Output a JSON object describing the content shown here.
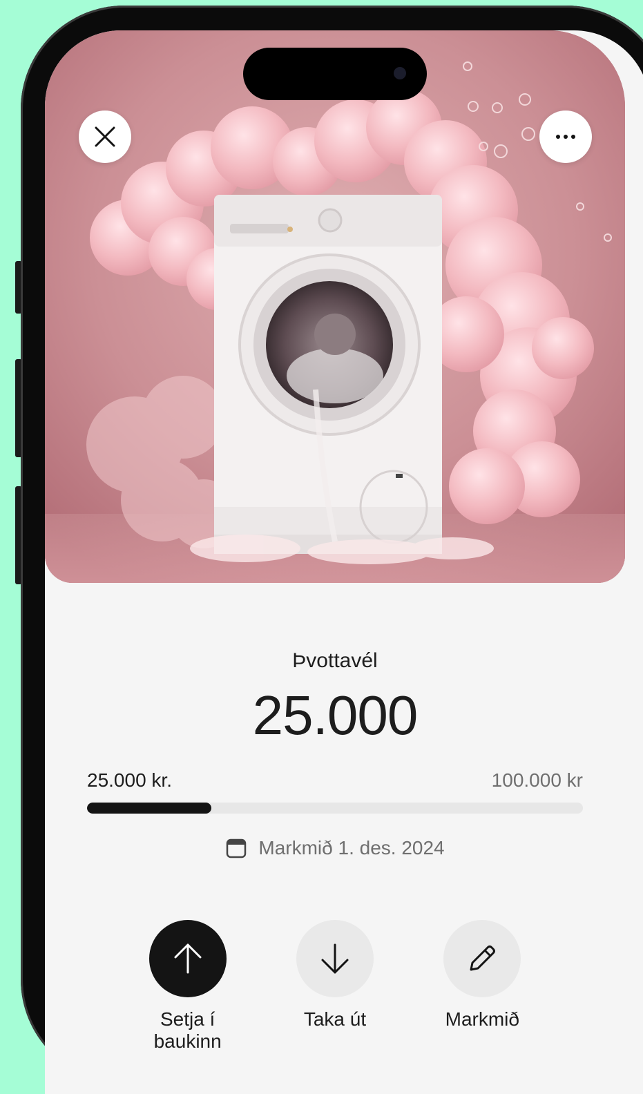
{
  "goal": {
    "name": "Þvottavél",
    "amount": "25.000",
    "saved_label": "25.000 kr.",
    "target_label": "100.000 kr",
    "progress": 0.25,
    "date_label": "Markmið 1. des. 2024"
  },
  "actions": [
    {
      "label": "Setja í baukinn"
    },
    {
      "label": "Taka út"
    },
    {
      "label": "Markmið"
    }
  ],
  "colors": {
    "background": "#a5fdd6",
    "primary": "#141414",
    "progress_track": "#e7e7e7"
  },
  "icons": {
    "close": "close-icon",
    "more": "more-icon",
    "deposit": "arrow-up-icon",
    "withdraw": "arrow-down-icon",
    "edit": "pencil-icon",
    "date": "calendar-icon"
  }
}
